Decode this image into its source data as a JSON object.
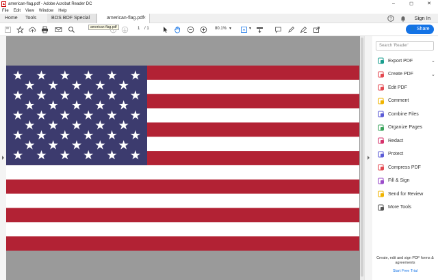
{
  "window": {
    "title": "american-flag.pdf - Adobe Acrobat Reader DC",
    "controls": [
      "–",
      "◻",
      "✕"
    ]
  },
  "menu": [
    "File",
    "Edit",
    "View",
    "Window",
    "Help"
  ],
  "tabs": {
    "home": "Home",
    "tools": "Tools",
    "doc1": "BOS BOF Special M...",
    "doc2": "american-flag.pdf",
    "close": "×",
    "signin": "Sign In"
  },
  "toolbar": {
    "tooltip": "american-flag.pdf",
    "page_current": "1",
    "page_total": "/ 1",
    "zoom": "80.1%",
    "share": "Share"
  },
  "flag": {
    "stripes": 13,
    "stars": 50,
    "red": "#b22234",
    "white": "#ffffff",
    "blue": "#3c3b6e"
  },
  "right_panel": {
    "search_placeholder": "Search 'Reader'",
    "tools": [
      {
        "label": "Export PDF",
        "icon": "export-pdf-icon",
        "color": "#1a9e8f",
        "expand": true
      },
      {
        "label": "Create PDF",
        "icon": "create-pdf-icon",
        "color": "#e34850",
        "expand": true
      },
      {
        "label": "Edit PDF",
        "icon": "edit-pdf-icon",
        "color": "#e34850",
        "expand": false
      },
      {
        "label": "Comment",
        "icon": "comment-icon",
        "color": "#f0b400",
        "expand": false
      },
      {
        "label": "Combine Files",
        "icon": "combine-files-icon",
        "color": "#5b5bd6",
        "expand": false
      },
      {
        "label": "Organize Pages",
        "icon": "organize-pages-icon",
        "color": "#3aa35b",
        "expand": false
      },
      {
        "label": "Redact",
        "icon": "redact-icon",
        "color": "#d6336c",
        "expand": false
      },
      {
        "label": "Protect",
        "icon": "protect-icon",
        "color": "#5b5bd6",
        "expand": false
      },
      {
        "label": "Compress PDF",
        "icon": "compress-pdf-icon",
        "color": "#e34850",
        "expand": false
      },
      {
        "label": "Fill & Sign",
        "icon": "fill-sign-icon",
        "color": "#9b4dca",
        "expand": false
      },
      {
        "label": "Send for Review",
        "icon": "send-review-icon",
        "color": "#f0b400",
        "expand": false
      },
      {
        "label": "More Tools",
        "icon": "more-tools-icon",
        "color": "#555555",
        "expand": false
      }
    ],
    "promo_text": "Create, edit and sign PDF forms & agreements",
    "promo_link": "Start Free Trial"
  }
}
